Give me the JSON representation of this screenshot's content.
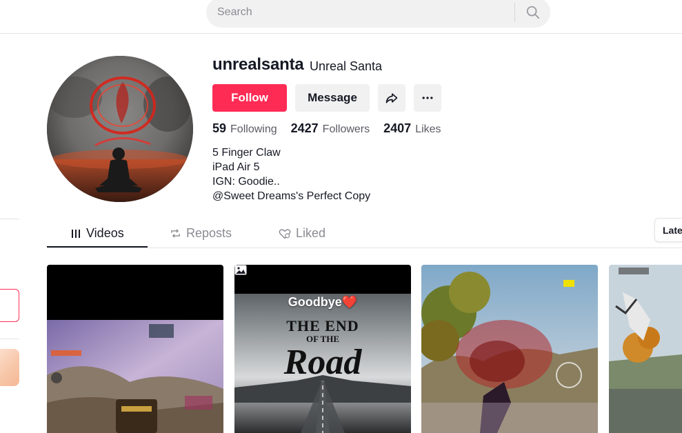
{
  "search": {
    "placeholder": "Search"
  },
  "profile": {
    "username": "unrealsanta",
    "nickname": "Unreal Santa",
    "follow_label": "Follow",
    "message_label": "Message",
    "share_icon": "share-icon",
    "more_icon": "more-icon",
    "stats": [
      {
        "value": "59",
        "label": "Following"
      },
      {
        "value": "2427",
        "label": "Followers"
      },
      {
        "value": "2407",
        "label": "Likes"
      }
    ],
    "bio": [
      "5 Finger Claw",
      "iPad Air 5",
      "IGN: Goodie..",
      "@Sweet Dreams's Perfect Copy"
    ]
  },
  "tabs": [
    {
      "label": "Videos",
      "icon": "grid-icon",
      "active": true
    },
    {
      "label": "Reposts",
      "icon": "repost-icon",
      "active": false
    },
    {
      "label": "Liked",
      "icon": "liked-heart-icon",
      "active": false
    }
  ],
  "sort": {
    "label": "Lates"
  },
  "videos": [
    {
      "overlay_text": ""
    },
    {
      "overlay_text": "Goodbye❤️",
      "title_line1": "THE END",
      "title_line2": "OF THE",
      "title_line3": "Road",
      "badge_icon": "photo-icon"
    },
    {
      "overlay_text": ""
    },
    {
      "overlay_text": ""
    }
  ],
  "colors": {
    "accent": "#fe2c55",
    "text": "#161823",
    "muted": "#8a8b91",
    "button_bg": "#f1f1f2"
  }
}
